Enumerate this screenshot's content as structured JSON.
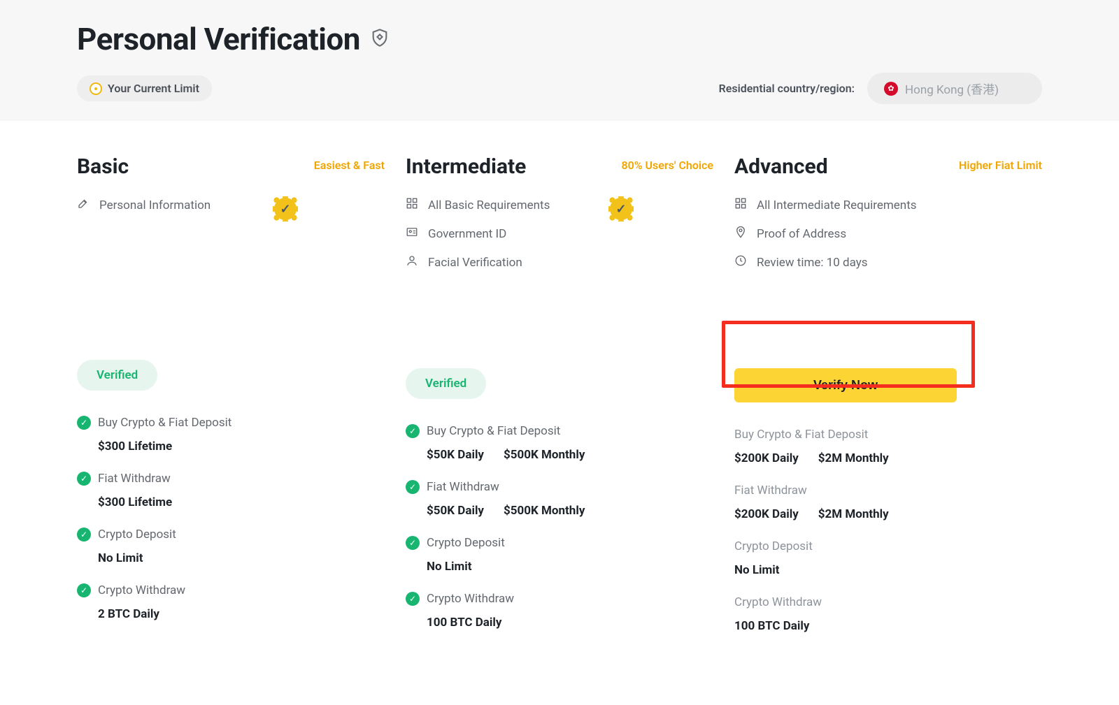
{
  "header": {
    "title": "Personal Verification",
    "current_limit_label": "Your Current Limit",
    "region_label": "Residential country/region:",
    "region_value": "Hong Kong (香港)"
  },
  "tiers": {
    "basic": {
      "title": "Basic",
      "tag": "Easiest & Fast",
      "requirements": [
        {
          "label": "Personal Information",
          "icon": "edit"
        }
      ],
      "status": "Verified",
      "status_label": "Verified",
      "limits": [
        {
          "title": "Buy Crypto & Fiat Deposit",
          "checked": true,
          "values": [
            "$300 Lifetime"
          ]
        },
        {
          "title": "Fiat Withdraw",
          "checked": true,
          "values": [
            "$300 Lifetime"
          ]
        },
        {
          "title": "Crypto Deposit",
          "checked": true,
          "values": [
            "No Limit"
          ]
        },
        {
          "title": "Crypto Withdraw",
          "checked": true,
          "values": [
            "2 BTC Daily"
          ]
        }
      ]
    },
    "intermediate": {
      "title": "Intermediate",
      "tag": "80% Users' Choice",
      "requirements": [
        {
          "label": "All Basic Requirements",
          "icon": "grid"
        },
        {
          "label": "Government ID",
          "icon": "id"
        },
        {
          "label": "Facial Verification",
          "icon": "person"
        }
      ],
      "status": "Verified",
      "status_label": "Verified",
      "limits": [
        {
          "title": "Buy Crypto & Fiat Deposit",
          "checked": true,
          "values": [
            "$50K Daily",
            "$500K Monthly"
          ]
        },
        {
          "title": "Fiat Withdraw",
          "checked": true,
          "values": [
            "$50K Daily",
            "$500K Monthly"
          ]
        },
        {
          "title": "Crypto Deposit",
          "checked": true,
          "values": [
            "No Limit"
          ]
        },
        {
          "title": "Crypto Withdraw",
          "checked": true,
          "values": [
            "100 BTC Daily"
          ]
        }
      ]
    },
    "advanced": {
      "title": "Advanced",
      "tag": "Higher Fiat Limit",
      "requirements": [
        {
          "label": "All Intermediate Requirements",
          "icon": "grid"
        },
        {
          "label": "Proof of Address",
          "icon": "pin"
        },
        {
          "label": "Review time: 10 days",
          "icon": "clock"
        }
      ],
      "status": "Action",
      "action_label": "Verify Now",
      "limits": [
        {
          "title": "Buy Crypto & Fiat Deposit",
          "checked": false,
          "values": [
            "$200K Daily",
            "$2M Monthly"
          ]
        },
        {
          "title": "Fiat Withdraw",
          "checked": false,
          "values": [
            "$200K Daily",
            "$2M Monthly"
          ]
        },
        {
          "title": "Crypto Deposit",
          "checked": false,
          "values": [
            "No Limit"
          ]
        },
        {
          "title": "Crypto Withdraw",
          "checked": false,
          "values": [
            "100 BTC Daily"
          ]
        }
      ]
    }
  }
}
